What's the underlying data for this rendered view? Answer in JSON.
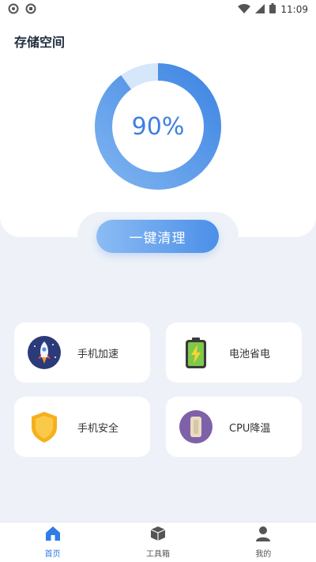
{
  "status_bar": {
    "time": "11:09"
  },
  "storage": {
    "title": "存储空间",
    "percent_text": "90%",
    "used_fraction": 0.9,
    "ring_color": "#4b8fe8",
    "ring_track_color": "#cfe2fb"
  },
  "clean_button": {
    "label": "一键清理"
  },
  "tools": [
    {
      "label": "手机加速",
      "icon": "rocket-icon"
    },
    {
      "label": "电池省电",
      "icon": "battery-icon"
    },
    {
      "label": "手机安全",
      "icon": "shield-icon"
    },
    {
      "label": "CPU降温",
      "icon": "thermometer-icon"
    }
  ],
  "nav": [
    {
      "label": "首页",
      "icon": "home-icon",
      "active": true
    },
    {
      "label": "工具箱",
      "icon": "box-icon",
      "active": false
    },
    {
      "label": "我的",
      "icon": "user-icon",
      "active": false
    }
  ],
  "colors": {
    "accent": "#2f7de6",
    "background": "#eef2f8"
  }
}
